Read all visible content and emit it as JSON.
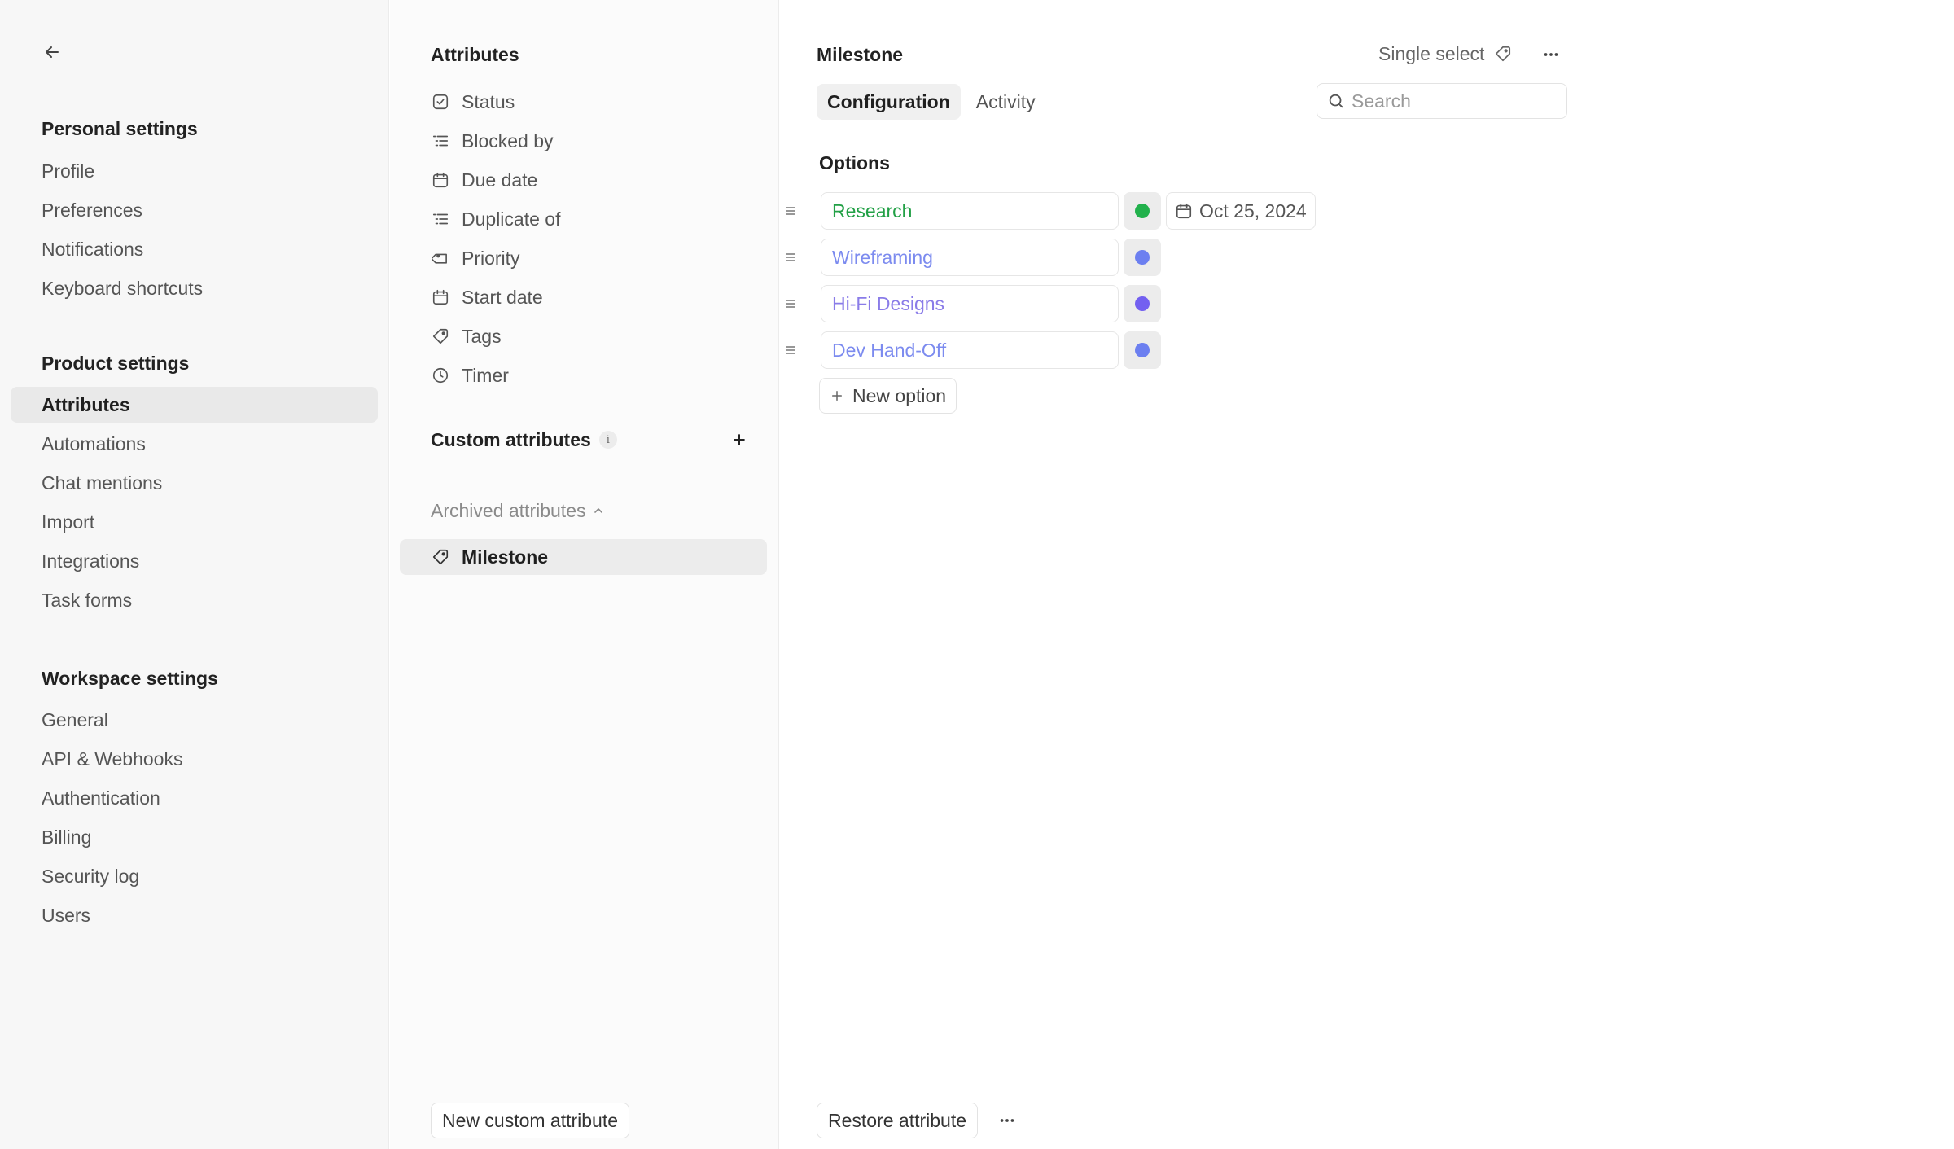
{
  "nav": {
    "back_icon": "arrow-left-icon",
    "personal": {
      "title": "Personal settings",
      "items": [
        "Profile",
        "Preferences",
        "Notifications",
        "Keyboard shortcuts"
      ]
    },
    "product": {
      "title": "Product settings",
      "items": [
        "Attributes",
        "Automations",
        "Chat mentions",
        "Import",
        "Integrations",
        "Task forms"
      ],
      "active": "Attributes"
    },
    "workspace": {
      "title": "Workspace settings",
      "items": [
        "General",
        "API & Webhooks",
        "Authentication",
        "Billing",
        "Security log",
        "Users"
      ]
    }
  },
  "attributes": {
    "title": "Attributes",
    "items": [
      {
        "label": "Status",
        "icon": "checkbox-icon"
      },
      {
        "label": "Blocked by",
        "icon": "list-indent-icon"
      },
      {
        "label": "Due date",
        "icon": "calendar-icon"
      },
      {
        "label": "Duplicate of",
        "icon": "list-indent-icon"
      },
      {
        "label": "Priority",
        "icon": "tag-icon"
      },
      {
        "label": "Start date",
        "icon": "calendar-icon"
      },
      {
        "label": "Tags",
        "icon": "tag-icon"
      },
      {
        "label": "Timer",
        "icon": "clock-icon"
      }
    ],
    "custom_title": "Custom attributes",
    "custom_info": "i",
    "archived_label": "Archived attributes",
    "archived_items": [
      {
        "label": "Milestone",
        "icon": "tag-icon"
      }
    ],
    "new_custom_button": "New custom attribute"
  },
  "detail": {
    "title": "Milestone",
    "type_label": "Single select",
    "tabs": [
      "Configuration",
      "Activity"
    ],
    "active_tab": "Configuration",
    "search_placeholder": "Search",
    "options_label": "Options",
    "options": [
      {
        "label": "Research",
        "color": "#22b14c",
        "date": "Oct 25, 2024"
      },
      {
        "label": "Wireframing",
        "color": "#6c7ff0",
        "date": ""
      },
      {
        "label": "Hi-Fi Designs",
        "color": "#7360f0",
        "date": ""
      },
      {
        "label": "Dev Hand-Off",
        "color": "#6c7ff0",
        "date": ""
      }
    ],
    "new_option_label": "New option",
    "restore_button": "Restore attribute"
  }
}
